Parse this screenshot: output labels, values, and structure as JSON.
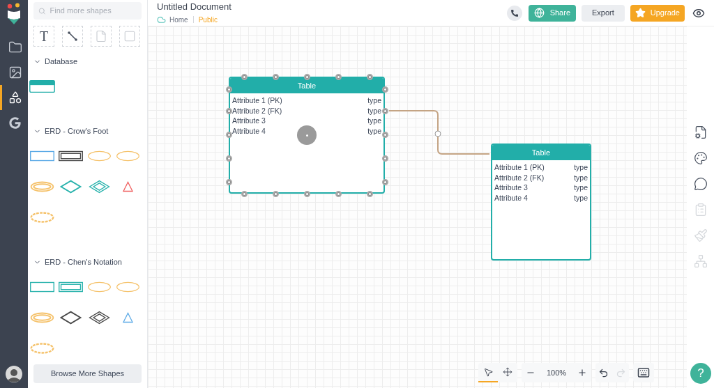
{
  "rail": {
    "items": [
      {
        "kind": "folder",
        "selected": false
      },
      {
        "kind": "image",
        "selected": false
      },
      {
        "kind": "shapes",
        "selected": true
      },
      {
        "kind": "google",
        "selected": false
      }
    ]
  },
  "header": {
    "title": "Untitled Document",
    "breadcrumb": {
      "home": "Home",
      "visibility": "Public"
    },
    "buttons": [
      {
        "kind": "call"
      },
      {
        "kind": "share",
        "label": "Share"
      },
      {
        "kind": "export",
        "label": "Export"
      },
      {
        "kind": "upgrade",
        "label": "Upgrade"
      },
      {
        "kind": "preview"
      }
    ]
  },
  "shape_panel": {
    "search": {
      "placeholder": "Find more shapes"
    },
    "tools": [
      {
        "kind": "text",
        "label": "T"
      },
      {
        "kind": "line"
      },
      {
        "kind": "note"
      },
      {
        "kind": "box"
      }
    ],
    "sections": [
      {
        "title": "Database",
        "expanded": true,
        "shapes": [
          {
            "kind": "table",
            "color": "#22aea9"
          }
        ]
      },
      {
        "title": "ERD - Crow's Foot",
        "expanded": true,
        "shapes": [
          {
            "kind": "rect",
            "color": "#5aa9e6"
          },
          {
            "kind": "double-rect",
            "color": "#4a4a4a"
          },
          {
            "kind": "ellipse",
            "color": "#f5c26b"
          },
          {
            "kind": "ellipse",
            "color": "#f5c26b"
          },
          {
            "kind": "double-ellipse",
            "color": "#f5c26b"
          },
          {
            "kind": "diamond",
            "color": "#2bb3ad"
          },
          {
            "kind": "double-diamond",
            "color": "#2bb3ad"
          },
          {
            "kind": "triangle",
            "color": "#ef5b5b"
          },
          {
            "kind": "dotted-ellipse",
            "color": "#f5c26b"
          }
        ]
      },
      {
        "title": "ERD - Chen's Notation",
        "expanded": true,
        "shapes": [
          {
            "kind": "rect",
            "color": "#2bb3ad"
          },
          {
            "kind": "double-rect",
            "color": "#2bb3ad"
          },
          {
            "kind": "ellipse",
            "color": "#f5c26b"
          },
          {
            "kind": "ellipse",
            "color": "#f5c26b"
          },
          {
            "kind": "double-ellipse",
            "color": "#f5c26b"
          },
          {
            "kind": "diamond",
            "color": "#4a4a4a"
          },
          {
            "kind": "double-diamond",
            "color": "#4a4a4a"
          },
          {
            "kind": "triangle",
            "color": "#5aa9e6"
          },
          {
            "kind": "dotted-ellipse",
            "color": "#f5c26b"
          }
        ]
      }
    ],
    "browse_button": "Browse More Shapes"
  },
  "canvas": {
    "tables": [
      {
        "title": "Table",
        "selected": true,
        "rows": [
          {
            "name": "Attribute 1 (PK)",
            "type": "type"
          },
          {
            "name": "Attribute 2 (FK)",
            "type": "type"
          },
          {
            "name": "Attribute 3",
            "type": "type"
          },
          {
            "name": "Attribute 4",
            "type": "type"
          }
        ]
      },
      {
        "title": "Table",
        "selected": false,
        "rows": [
          {
            "name": "Attribute 1 (PK)",
            "type": "type"
          },
          {
            "name": "Attribute 2 (FK)",
            "type": "type"
          },
          {
            "name": "Attribute 3",
            "type": "type"
          },
          {
            "name": "Attribute 4",
            "type": "type"
          }
        ]
      }
    ]
  },
  "right_rail": [
    {
      "kind": "page-settings",
      "disabled": false
    },
    {
      "kind": "palette",
      "disabled": false
    },
    {
      "kind": "comments",
      "disabled": false
    },
    {
      "kind": "notes",
      "disabled": true
    },
    {
      "kind": "brush",
      "disabled": true
    },
    {
      "kind": "hierarchy",
      "disabled": true
    }
  ],
  "toolbar": {
    "tools": [
      {
        "kind": "select",
        "selected": true
      },
      {
        "kind": "pan",
        "selected": false
      }
    ],
    "zoom": "100%",
    "undo": {
      "disabled": false
    },
    "redo": {
      "disabled": true
    }
  },
  "help_button": "?"
}
